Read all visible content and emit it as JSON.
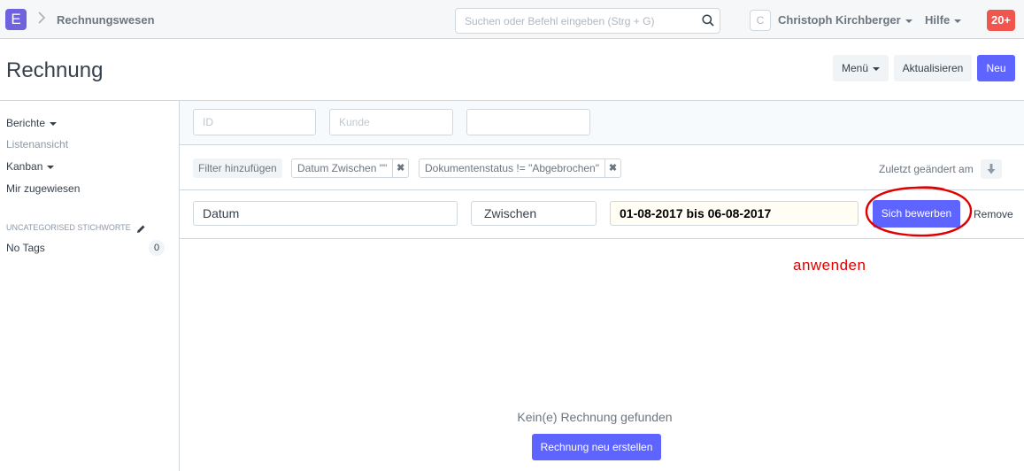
{
  "navbar": {
    "logo_letter": "E",
    "breadcrumb": "Rechnungswesen",
    "search_placeholder": "Suchen oder Befehl eingeben (Strg + G)",
    "avatar_letter": "C",
    "user_name": "Christoph Kirchberger",
    "help_label": "Hilfe",
    "notification_count": "20+"
  },
  "page": {
    "title": "Rechnung",
    "menu_button": "Menü",
    "refresh_button": "Aktualisieren",
    "new_button": "Neu"
  },
  "sidebar": {
    "reports": "Berichte",
    "list_view": "Listenansicht",
    "kanban": "Kanban",
    "assigned_to_me": "Mir zugewiesen",
    "tags_heading": "UNCATEGORISED STICHWORTE",
    "no_tags_label": "No Tags",
    "no_tags_count": "0"
  },
  "filters": {
    "id_placeholder": "ID",
    "customer_placeholder": "Kunde",
    "third_placeholder": "",
    "add_filter": "Filter hinzufügen",
    "chips": [
      {
        "label": "Datum Zwischen \"\""
      },
      {
        "label": "Dokumentenstatus != \"Abgebrochen\""
      }
    ],
    "chip_remove_symbol": "✖",
    "sort_label": "Zuletzt geändert am"
  },
  "filter_editor": {
    "field": "Datum",
    "condition": "Zwischen",
    "value": "01-08-2017 bis 06-08-2017",
    "apply_button": "Sich bewerben",
    "remove_link": "Remove"
  },
  "annotation": {
    "text": "anwenden",
    "color": "#e00000"
  },
  "empty_state": {
    "message": "Kein(e) Rechnung gefunden",
    "create_button": "Rechnung neu erstellen"
  },
  "colors": {
    "primary": "#5e64ff",
    "logo": "#6e62de",
    "notification": "#f0564d"
  }
}
